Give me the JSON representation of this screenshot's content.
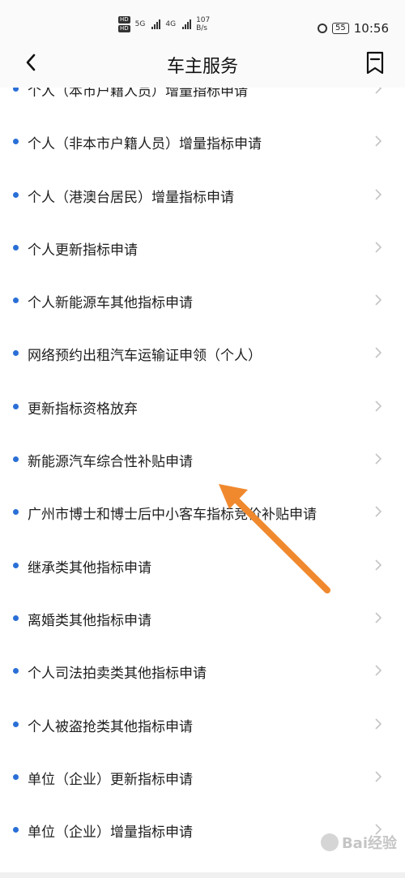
{
  "status_bar": {
    "network_1": "5G",
    "network_2": "4G",
    "speed_value": "107",
    "speed_unit": "B/s",
    "battery": "55",
    "time": "10:56",
    "hd_badge": "HD"
  },
  "header": {
    "title": "车主服务"
  },
  "list": {
    "items": [
      {
        "label": "个人（本市户籍人员）增量指标申请"
      },
      {
        "label": "个人（非本市户籍人员）增量指标申请"
      },
      {
        "label": "个人（港澳台居民）增量指标申请"
      },
      {
        "label": "个人更新指标申请"
      },
      {
        "label": "个人新能源车其他指标申请"
      },
      {
        "label": "网络预约出租汽车运输证申领（个人）"
      },
      {
        "label": "更新指标资格放弃"
      },
      {
        "label": "新能源汽车综合性补贴申请"
      },
      {
        "label": "广州市博士和博士后中小客车指标竞价补贴申请"
      },
      {
        "label": "继承类其他指标申请"
      },
      {
        "label": "离婚类其他指标申请"
      },
      {
        "label": "个人司法拍卖类其他指标申请"
      },
      {
        "label": "个人被盗抢类其他指标申请"
      },
      {
        "label": "单位（企业）更新指标申请"
      },
      {
        "label": "单位（企业）增量指标申请"
      }
    ]
  },
  "watermark": {
    "text": "Bai经验"
  },
  "colors": {
    "accent_dot": "#2a6fd6",
    "annotation_arrow": "#f0892e"
  }
}
